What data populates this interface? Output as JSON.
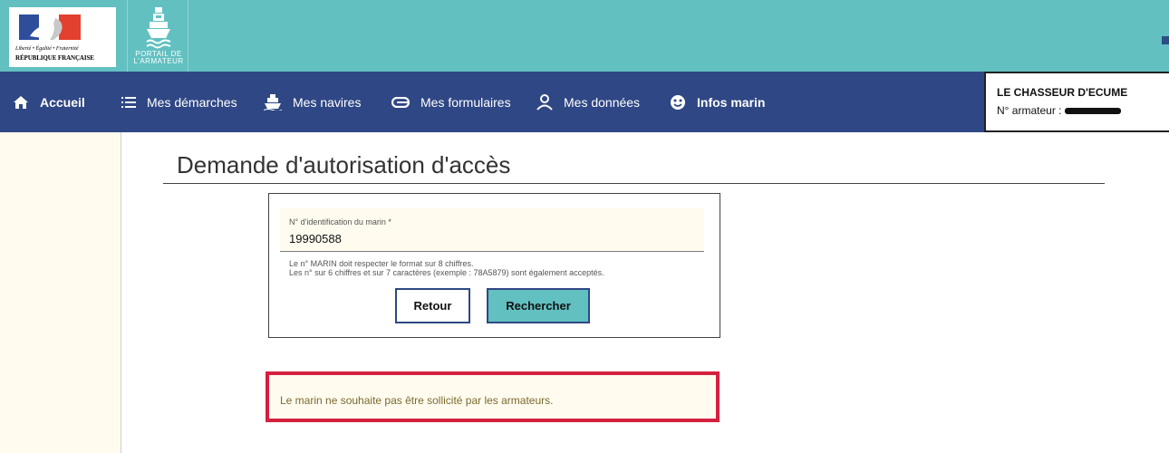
{
  "header": {
    "rf_logo": {
      "motto": "Liberté • Égalité • Fraternité",
      "name": "RÉPUBLIQUE FRANÇAISE"
    },
    "portal": {
      "line1": "PORTAIL DE",
      "line2": "L'ARMATEUR",
      "icon": "ship-icon"
    },
    "colors": {
      "banner": "#62c0c1",
      "nav": "#2f4784",
      "accent_red": "#d5203f"
    }
  },
  "nav": {
    "items": [
      {
        "label": "Accueil",
        "icon": "home-icon"
      },
      {
        "label": "Mes démarches",
        "icon": "list-icon"
      },
      {
        "label": "Mes navires",
        "icon": "ship-icon"
      },
      {
        "label": "Mes formulaires",
        "icon": "link-icon"
      },
      {
        "label": "Mes données",
        "icon": "user-icon"
      },
      {
        "label": "Infos marin",
        "icon": "face-icon"
      }
    ]
  },
  "user": {
    "name": "LE CHASSEUR D'ECUME",
    "number_label": "N° armateur :"
  },
  "main": {
    "title": "Demande d'autorisation d'accès",
    "form": {
      "field_label": "N° d'identification du marin *",
      "field_value": "19990588",
      "hint1": "Le n° MARIN doit respecter le format sur 8 chiffres.",
      "hint2": "Les n° sur 6 chiffres et sur 7 caractères (exemple : 78A5879) sont également acceptés.",
      "back_label": "Retour",
      "search_label": "Rechercher"
    },
    "alert": "Le marin ne souhaite pas être sollicité par les armateurs."
  }
}
